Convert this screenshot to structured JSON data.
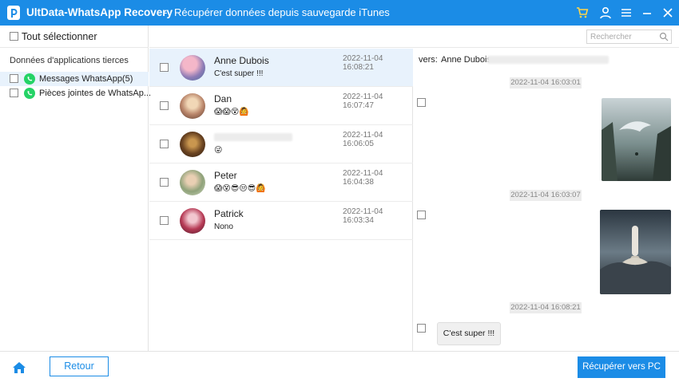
{
  "titlebar": {
    "app_name": "UltData-WhatsApp Recovery",
    "separator": "-",
    "subtitle": "Récupérer données depuis sauvegarde iTunes",
    "icons": [
      "cart-icon",
      "user-icon",
      "menu-icon",
      "minimize-icon",
      "close-icon"
    ],
    "background": "#1b8ce6"
  },
  "sidebar": {
    "select_all_label": "Tout sélectionner",
    "section_title": "Données d'applications tierces",
    "items": [
      {
        "label": "Messages WhatsApp(5)",
        "active": true
      },
      {
        "label": "Pièces jointes de WhatsAp...",
        "active": false
      }
    ]
  },
  "search": {
    "placeholder": "Rechercher"
  },
  "chats": [
    {
      "name": "Anne Dubois",
      "message": "C'est super !!!",
      "date": "2022-11-04 16:08:21",
      "active": true
    },
    {
      "name": "Dan",
      "message": "😱😱😵🙆",
      "date": "2022-11-04 16:07:47",
      "active": false
    },
    {
      "name": "",
      "message": "😜",
      "date": "2022-11-04 16:06:05",
      "active": false
    },
    {
      "name": "Peter",
      "message": "😱😵😎😒😎🙆",
      "date": "2022-11-04 16:04:38",
      "active": false
    },
    {
      "name": "Patrick",
      "message": "Nono",
      "date": "2022-11-04 16:03:34",
      "active": false
    }
  ],
  "detail": {
    "to_label": "vers:",
    "to_name": "Anne Dubois",
    "timestamps": [
      "2022-11-04 16:03:01",
      "2022-11-04 16:03:07",
      "2022-11-04 16:08:21"
    ],
    "bubble_text": "C'est super !!!"
  },
  "footer": {
    "back_label": "Retour",
    "recover_label": "Récupérer vers PC"
  }
}
